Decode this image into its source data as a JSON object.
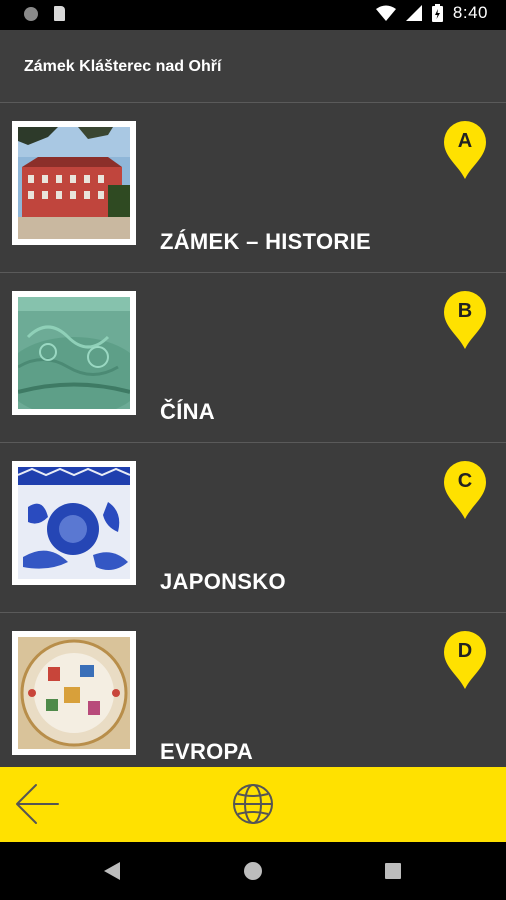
{
  "status_bar": {
    "time": "8:40"
  },
  "header": {
    "title": "Zámek Klášterec nad Ohří"
  },
  "items": [
    {
      "label": "ZÁMEK – HISTORIE",
      "pin": "A",
      "image": "castle-photo"
    },
    {
      "label": "ČÍNA",
      "pin": "B",
      "image": "celadon-vase-photo"
    },
    {
      "label": "JAPONSKO",
      "pin": "C",
      "image": "blue-porcelain-photo"
    },
    {
      "label": "EVROPA",
      "pin": "D",
      "image": "painted-plate-photo"
    }
  ],
  "colors": {
    "accent": "#ffe100",
    "background": "#3c3c3c"
  }
}
